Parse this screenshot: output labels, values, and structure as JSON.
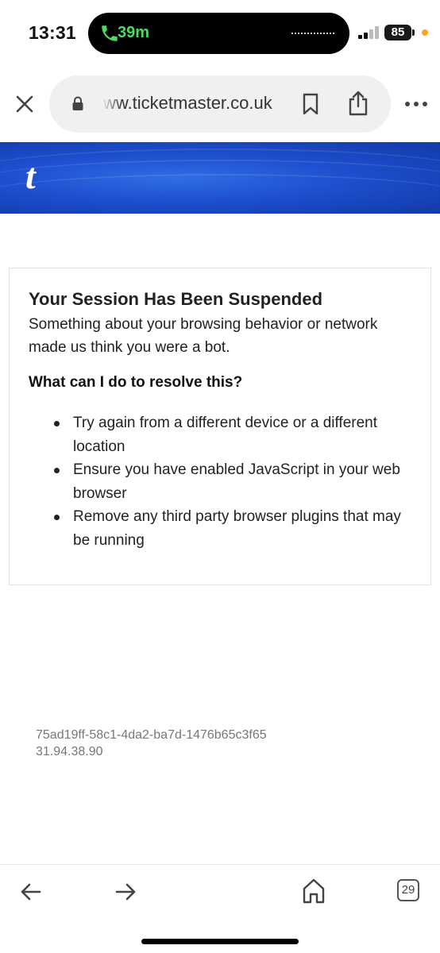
{
  "status_bar": {
    "time": "13:31",
    "call_duration": "39m",
    "battery_level": "85",
    "icons": [
      "phone-call-icon",
      "audio-waveform-icon",
      "cellular-signal-icon",
      "battery-icon",
      "privacy-indicator-dot"
    ],
    "colors": {
      "call_green": "#4cd964",
      "privacy_dot": "#f5a623"
    }
  },
  "browser": {
    "url": "ww.ticketmaster.co.uk",
    "icons": [
      "close-icon",
      "lock-icon",
      "bookmark-icon",
      "share-icon",
      "more-icon"
    ]
  },
  "banner": {
    "logo_text": "t",
    "color": "#1e4fcf"
  },
  "card": {
    "title": "Your Session Has Been Suspended",
    "description": "Something about your browsing behavior or network made us think you were a bot.",
    "subheading": "What can I do to resolve this?",
    "items": [
      "Try again from a different device or a different location",
      "Ensure you have enabled JavaScript in your web browser",
      "Remove any third party browser plugins that may be running"
    ]
  },
  "reference": {
    "id": "75ad19ff-58c1-4da2-ba7d-1476b65c3f65",
    "ip": "31.94.38.90"
  },
  "bottom_bar": {
    "tab_count": "29",
    "icons": [
      "back-arrow-icon",
      "forward-arrow-icon",
      "home-icon",
      "tabs-icon"
    ]
  }
}
